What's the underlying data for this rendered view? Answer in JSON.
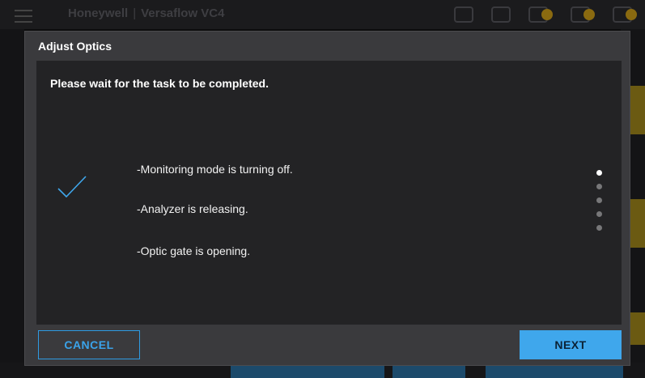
{
  "background_app": {
    "brand": "Honeywell",
    "product": "Versaflow VC4"
  },
  "dialog": {
    "title": "Adjust Optics",
    "message": "Please wait for the task to be completed.",
    "status_icon": "checkmark-icon",
    "steps": [
      "-Monitoring mode is turning off.",
      "-Analyzer is releasing.",
      "-Optic gate is opening."
    ],
    "progress": {
      "total_dots": 5,
      "active_index": 0
    },
    "buttons": {
      "cancel": "CANCEL",
      "next": "NEXT"
    }
  },
  "colors": {
    "accent": "#3fa7ec",
    "modal_bg": "#3a3a3d",
    "content_bg": "#232325",
    "text": "#ffffff"
  }
}
